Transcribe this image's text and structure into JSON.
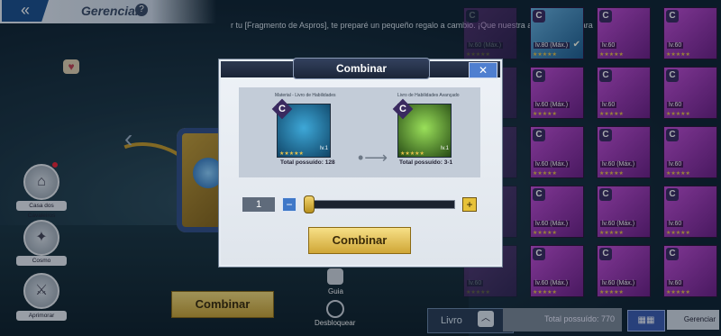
{
  "header": {
    "back_icon": "double-chevron-left-icon",
    "title": "Gerenciar",
    "help": "?"
  },
  "dialog": {
    "text": "r tu [Fragmento de Aspros], te preparé un pequeño regalo a cambio. ¡Que nuestra amistad dure para"
  },
  "side_menu": [
    {
      "label": "Casa dos Cavaleiros",
      "icon": "house-icon"
    },
    {
      "label": "Cosmo",
      "icon": "cosmo-icon"
    },
    {
      "label": "Aprimorar",
      "icon": "upgrade-icon"
    }
  ],
  "main": {
    "combinar_label": "Combinar",
    "guia_label": "Guia",
    "desbloquear_label": "Desbloquear"
  },
  "cards": [
    {
      "lv": "lv.60 (Máx.)",
      "state": "dim"
    },
    {
      "lv": "lv.80 (Máx.)",
      "state": "selected"
    },
    {
      "lv": "lv.60",
      "state": "normal"
    },
    {
      "lv": "lv.60",
      "state": "normal"
    },
    {
      "lv": "lv.60 (Máx.)",
      "state": "dim"
    },
    {
      "lv": "lv.60 (Máx.)",
      "state": "normal"
    },
    {
      "lv": "lv.60",
      "state": "normal"
    },
    {
      "lv": "lv.60",
      "state": "normal"
    },
    {
      "lv": "lv.60",
      "state": "dim"
    },
    {
      "lv": "lv.60 (Máx.)",
      "state": "normal"
    },
    {
      "lv": "lv.60 (Máx.)",
      "state": "normal"
    },
    {
      "lv": "lv.60",
      "state": "normal"
    },
    {
      "lv": "lv.60",
      "state": "dim"
    },
    {
      "lv": "lv.60 (Máx.)",
      "state": "normal"
    },
    {
      "lv": "lv.60 (Máx.)",
      "state": "normal"
    },
    {
      "lv": "lv.60",
      "state": "normal"
    },
    {
      "lv": "lv.60",
      "state": "dim"
    },
    {
      "lv": "lv.60 (Máx.)",
      "state": "normal"
    },
    {
      "lv": "lv.60 (Máx.)",
      "state": "normal"
    },
    {
      "lv": "lv.60",
      "state": "normal"
    },
    {
      "lv": "lv.60",
      "state": "dim"
    },
    {
      "lv": "lv.60 (Máx.)",
      "state": "normal"
    },
    {
      "lv": "lv.60 (Máx.)",
      "state": "normal"
    },
    {
      "lv": "lv.60",
      "state": "normal"
    }
  ],
  "bottom_bar": {
    "livro_label": "Livro",
    "total_label": "Total possuído: 770",
    "gerenciar_label": "Gerenciar"
  },
  "modal": {
    "title": "Combinar",
    "close_label": "✕",
    "material_label": "Material - Livro de Habilidades",
    "result_label": "Livro de Habilidades Avançado",
    "material": {
      "badge": "C",
      "level": "lv.1",
      "total": "Total possuído: 128"
    },
    "result": {
      "badge": "C",
      "level": "lv.1",
      "total": "Total possuído: 3-1"
    },
    "quantity": "1",
    "slider_fraction": 0.0,
    "minus_label": "−",
    "plus_label": "+",
    "button_label": "Combinar"
  },
  "colors": {
    "accent_gold": "#cfa636",
    "accent_blue": "#3f78c8",
    "card_purple": "#9b3fb5"
  }
}
